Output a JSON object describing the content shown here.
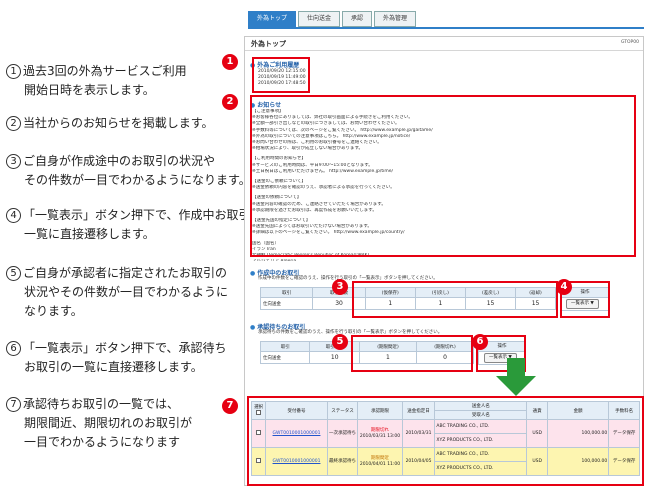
{
  "steps": [
    {
      "num": "1",
      "lines": [
        "過去3回の外為サービスご利用",
        "開始日時を表示します。"
      ]
    },
    {
      "num": "2",
      "lines": [
        "当社からのお知らせを掲載します。"
      ]
    },
    {
      "num": "3",
      "lines": [
        "ご自身が作成途中のお取引の状況や",
        "その件数が一目でわかるようになります。"
      ]
    },
    {
      "num": "4",
      "lines": [
        "「一覧表示」ボタン押下で、作成中お取引の",
        "一覧に直接遷移します。"
      ]
    },
    {
      "num": "5",
      "lines": [
        "ご自身が承認者に指定されたお取引の",
        "状況やその件数が一目でわかるように",
        "なります。"
      ]
    },
    {
      "num": "6",
      "lines": [
        "「一覧表示」ボタン押下で、承認待ち",
        "お取引の一覧に直接遷移します。"
      ]
    },
    {
      "num": "7",
      "lines": [
        "承認待ちお取引の一覧では、",
        "期限間近、期限切れのお取引が",
        "一目でわかるようになります"
      ]
    }
  ],
  "tabs": [
    "外為トップ",
    "仕向送金",
    "承認",
    "外為管理"
  ],
  "page": {
    "title": "外為トップ",
    "code": "GTOP00"
  },
  "login": {
    "heading": "外為ご利用履歴",
    "entries": [
      "2010/09/20 12:15:00",
      "2010/09/19 11:49:00",
      "2010/09/20 17:48:50"
    ]
  },
  "notice": {
    "heading": "お知らせ",
    "lines": [
      "【ご注意事項】",
      "※お客様各位にありましては、弊社の取引画面による手続きをご利用ください。",
      "※全額一部引き出しなどの取引につきましては、お問い合わせください。",
      "※手数料等については、次のページをご覧ください。 http://www.example.jp/gaitame/",
      "※外為の取引についての注意事項はこちら。 http://www.example.jp/notice/",
      "※お問い合わせの際は、ご利用のお取引番号をご連絡ください。",
      "※相場状況により、取引が成立しない場合があります。",
      "",
      "【ご利用時間のお知らせ】",
      "※サービスのご利用時間は、平日9:00〜15:00となります。",
      "※土日祝日はご利用いただけません。 http://www.example.jp/time/",
      "",
      "【送金のご依頼について】",
      "※送金依頼の内容を確認のうえ、承認者による承認を行ってください。",
      "",
      "【送金の依頼について】",
      "※送金内容の確認のため、ご連絡させていただく場合があります。",
      "※承認期限を過ぎたお取引は、再度作成をお願いいたします。",
      "",
      "【送金先国の指定について】",
      "※送金先国によってはお取引いただけない場合があります。",
      "※詳細は以下のページをご覧ください。 http://www.example.jp/country/",
      "",
      "国名（国名）",
      "イラン  Iran",
      "北朝鮮  Democratic People's Republic of Korea(DPRK)",
      "アルジェリア  Algeria",
      "ミャンマー  Myanmar",
      "",
      "※送金可能国の最新情報は随時更新されます。"
    ]
  },
  "drafts": {
    "heading": "作成中のお取引",
    "desc": "作成中の件数をご確認のうえ、操作を行う取引の「一覧表示」ボタンを押してください。",
    "headers": [
      "取引",
      "取引件数",
      "(仮保存)",
      "(引戻し)",
      "(差戻し)",
      "(返却)"
    ],
    "row": {
      "label": "仕向送金",
      "values": [
        "30",
        "1",
        "1",
        "15",
        "15"
      ]
    },
    "op_header": "操作",
    "button": "一覧表示 ▼"
  },
  "approvals": {
    "heading": "承認待ちのお取引",
    "desc": "承認待ちの件数をご確認のうえ、操作を行う取引の「一覧表示」ボタンを押してください。",
    "headers": [
      "取引",
      "取引件数",
      "(期限間近)",
      "(期限切れ)"
    ],
    "row": {
      "label": "仕向送金",
      "values": [
        "10",
        "1",
        "0"
      ]
    },
    "op_header": "操作",
    "button": "一覧表示 ▼"
  },
  "list": {
    "headers": [
      "選択",
      "受付番号",
      "ステータス",
      "承認期限",
      "送金指定日",
      "送金人名",
      "受取人名",
      "通貨",
      "金額",
      "手数料名"
    ],
    "select_all": "全選",
    "rows": [
      {
        "id": "GWT0010001000001",
        "status": "一次承認待ち",
        "deadline_label": "期限切れ",
        "deadline": "2010/03/31 13:00",
        "date": "2010/03/31",
        "sender": "ABC TRADING CO., LTD.",
        "receiver": "XYZ PRODUCTS CO., LTD.",
        "currency": "USD",
        "amount": "100,000.00",
        "fee": "データ保存"
      },
      {
        "id": "GWT0010001000001",
        "status": "最終承認待ち",
        "deadline_label": "期限間近",
        "deadline": "2010/04/01 11:00",
        "date": "2010/04/05",
        "sender": "ABC TRADING CO., LTD.",
        "receiver": "XYZ PRODUCTS CO., LTD.",
        "currency": "USD",
        "amount": "100,000.00",
        "fee": "データ保存"
      }
    ]
  },
  "badges": [
    "1",
    "2",
    "3",
    "4",
    "5",
    "6",
    "7"
  ],
  "colors": {
    "accent": "#2f7fc8",
    "callout": "#e60012",
    "arrow": "#2a9a3a",
    "expired_row": "#fde3ec",
    "near_row": "#fdf5b0"
  }
}
